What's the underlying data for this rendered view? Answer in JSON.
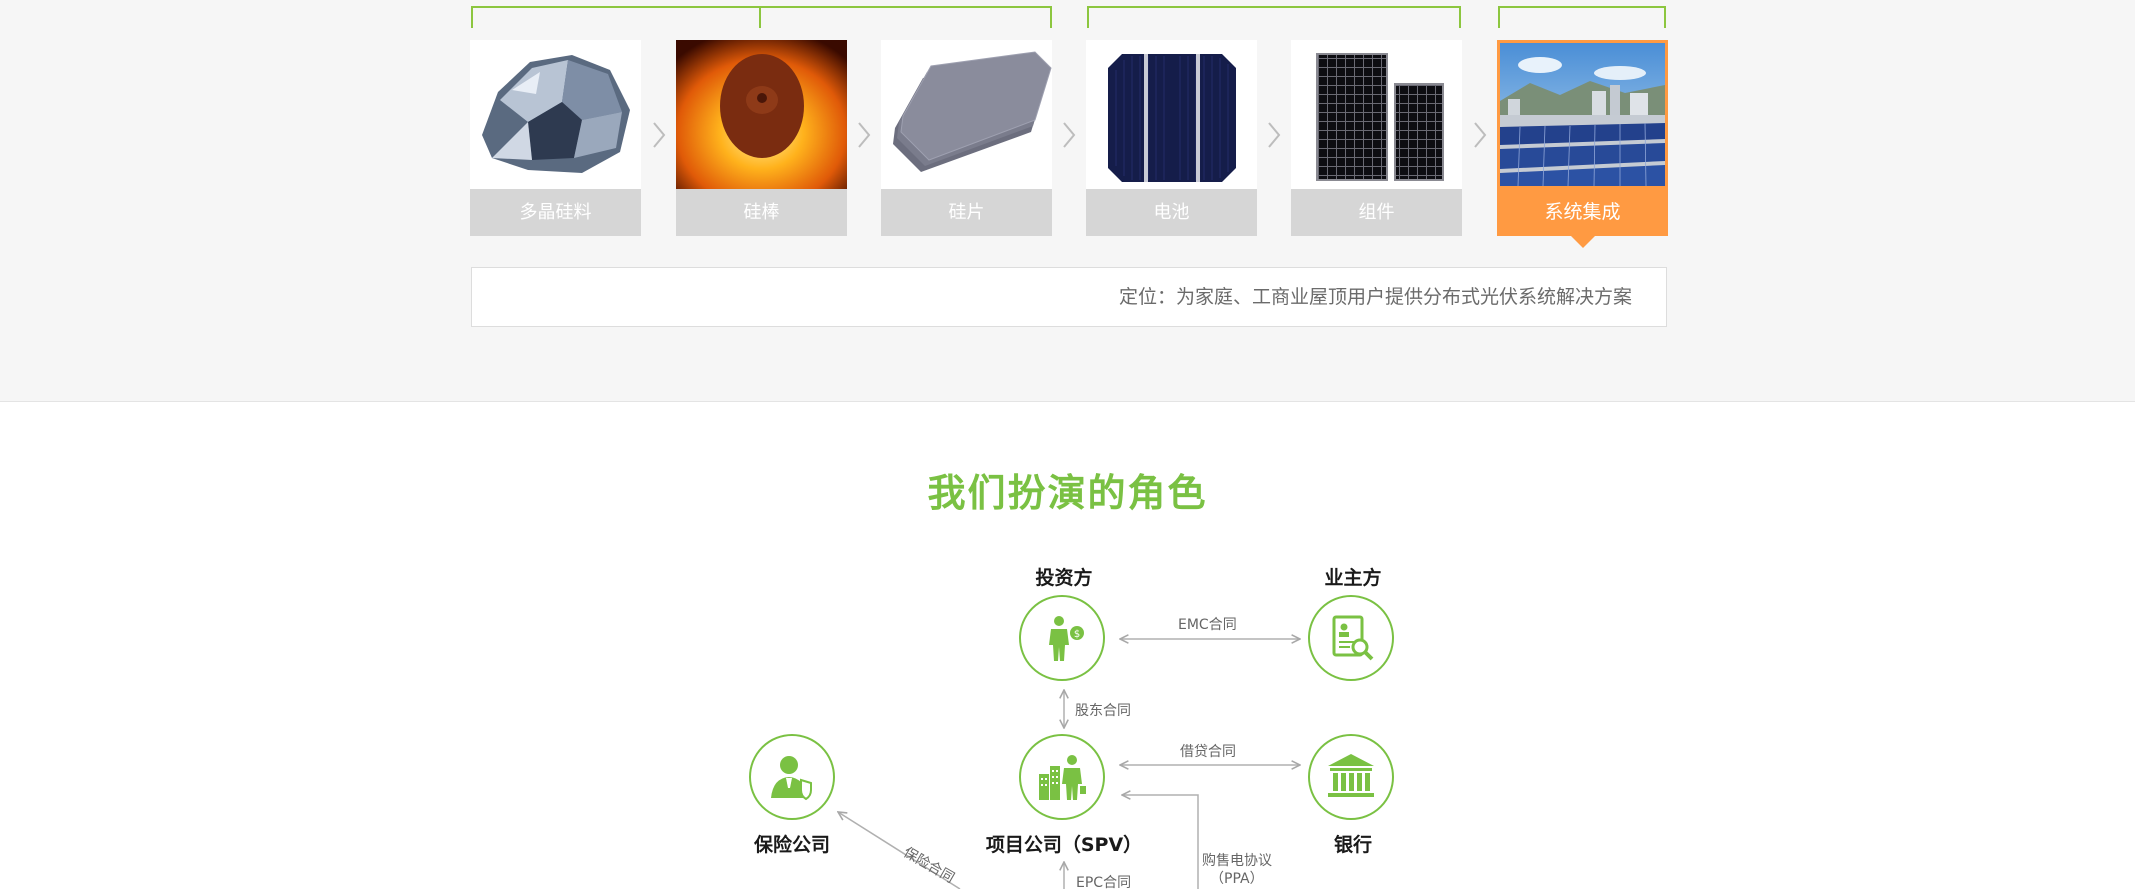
{
  "chain": {
    "steps": [
      {
        "label": "多晶硅料"
      },
      {
        "label": "硅棒"
      },
      {
        "label": "硅片"
      },
      {
        "label": "电池"
      },
      {
        "label": "组件"
      },
      {
        "label": "系统集成"
      }
    ],
    "active_step": "系统集成",
    "position": "定位：为家庭、工商业屋顶用户提供分布式光伏系统解决方案"
  },
  "roles": {
    "title": "我们扮演的角色",
    "nodes": {
      "investor": "投资方",
      "owner": "业主方",
      "insurance": "保险公司",
      "spv": "项目公司（SPV）",
      "bank": "银行"
    },
    "contracts": {
      "emc": "EMC合同",
      "shareholder": "股东合同",
      "loan": "借贷合同",
      "insurance": "保险合同",
      "ppa_line1": "购售电协议",
      "ppa_line2": "（PPA）",
      "epc": "EPC合同"
    }
  },
  "colors": {
    "accent_green": "#7ac143",
    "active_orange": "#ff9a42",
    "label_gray": "#d6d6d6"
  }
}
